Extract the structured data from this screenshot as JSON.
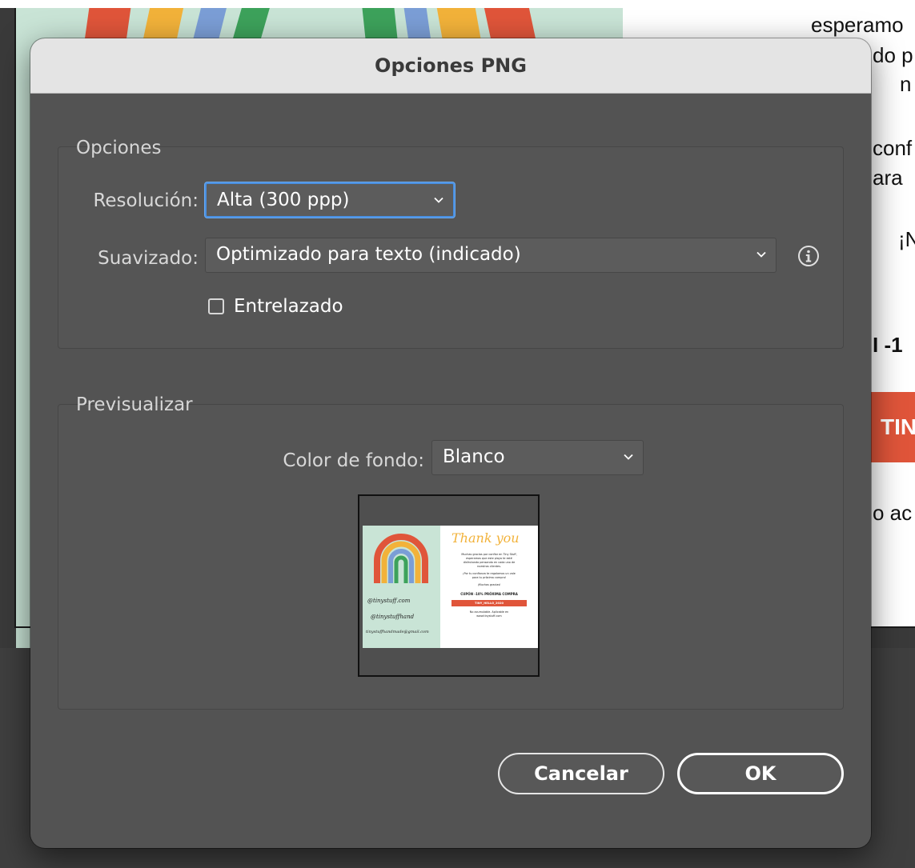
{
  "background_document": {
    "text_lines": [
      "esperamo",
      "do p",
      "n",
      "conf",
      "ara",
      "¡N",
      "I -1",
      "o ac"
    ],
    "button_label": "TIN",
    "colors": {
      "mint": "#c9e4d6",
      "stripe_red": "#e0553a",
      "stripe_yellow": "#f2b23a",
      "stripe_blue": "#7b9ed6",
      "stripe_green": "#3da25b",
      "button_red": "#e0553a"
    }
  },
  "dialog": {
    "title": "Opciones PNG",
    "options_group": {
      "label": "Opciones",
      "resolution": {
        "label": "Resolución:",
        "value": "Alta (300 ppp)"
      },
      "antialiasing": {
        "label": "Suavizado:",
        "value": "Optimizado para texto (indicado)",
        "info_icon": "info-icon"
      },
      "interlaced": {
        "label": "Entrelazado",
        "checked": false
      }
    },
    "preview_group": {
      "label": "Previsualizar",
      "background_color": {
        "label": "Color de fondo:",
        "value": "Blanco"
      },
      "thumbnail": {
        "left_lines": [
          "@tinystuff.com",
          "@tinystuffhand",
          "tinystuffhandmade@gmail.com"
        ],
        "title": "Thank you",
        "body_lines": [
          "Muchas gracias por confiar en Tiny Stuff,",
          "esperamos que este playa te esté",
          "disfrutando pensando en cada uno de",
          "nuestros clientes.",
          "¡Por tu confianza te regalamos un vale",
          "para tu próxima compra!",
          "¡Muchas gracias!"
        ],
        "coupon_heading": "CUPÓN -10% PRÓXIMA COMPRA",
        "coupon_code": "TINY_HELLO_2020",
        "footer_lines": [
          "No acumulable. Aplicable en",
          "www.tinystuff.com"
        ]
      }
    },
    "buttons": {
      "cancel": "Cancelar",
      "ok": "OK"
    },
    "accent_color": "#4a90e2"
  }
}
